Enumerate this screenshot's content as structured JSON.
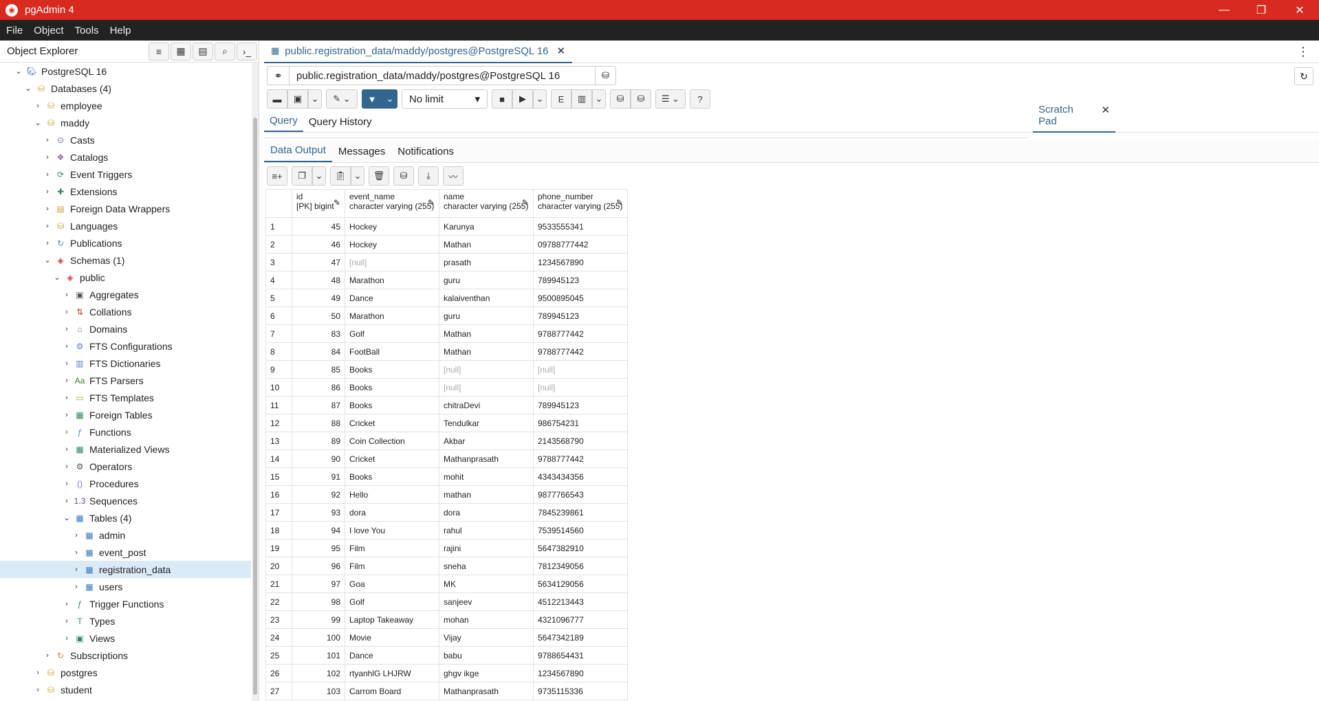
{
  "app": {
    "title": "pgAdmin 4",
    "accent_color": "#d92a1f",
    "brand_color": "#326690"
  },
  "menu": [
    "File",
    "Object",
    "Tools",
    "Help"
  ],
  "left_panel": {
    "title": "Object Explorer",
    "tree": [
      {
        "label": "PostgreSQL 16",
        "depth": 1,
        "expanded": true,
        "icon": "server-icon"
      },
      {
        "label": "Databases (4)",
        "depth": 2,
        "expanded": true,
        "icon": "databases-icon"
      },
      {
        "label": "employee",
        "depth": 3,
        "expanded": false,
        "icon": "database-error-icon"
      },
      {
        "label": "maddy",
        "depth": 3,
        "expanded": true,
        "icon": "database-icon"
      },
      {
        "label": "Casts",
        "depth": 4,
        "expanded": false,
        "icon": "casts-icon"
      },
      {
        "label": "Catalogs",
        "depth": 4,
        "expanded": false,
        "icon": "catalogs-icon"
      },
      {
        "label": "Event Triggers",
        "depth": 4,
        "expanded": false,
        "icon": "event-triggers-icon"
      },
      {
        "label": "Extensions",
        "depth": 4,
        "expanded": false,
        "icon": "extensions-icon"
      },
      {
        "label": "Foreign Data Wrappers",
        "depth": 4,
        "expanded": false,
        "icon": "fdw-icon"
      },
      {
        "label": "Languages",
        "depth": 4,
        "expanded": false,
        "icon": "languages-icon"
      },
      {
        "label": "Publications",
        "depth": 4,
        "expanded": false,
        "icon": "publications-icon"
      },
      {
        "label": "Schemas (1)",
        "depth": 4,
        "expanded": true,
        "icon": "schemas-icon"
      },
      {
        "label": "public",
        "depth": 5,
        "expanded": true,
        "icon": "schema-icon"
      },
      {
        "label": "Aggregates",
        "depth": 6,
        "expanded": false,
        "icon": "aggregates-icon"
      },
      {
        "label": "Collations",
        "depth": 6,
        "expanded": false,
        "icon": "collations-icon"
      },
      {
        "label": "Domains",
        "depth": 6,
        "expanded": false,
        "icon": "domains-icon"
      },
      {
        "label": "FTS Configurations",
        "depth": 6,
        "expanded": false,
        "icon": "fts-config-icon"
      },
      {
        "label": "FTS Dictionaries",
        "depth": 6,
        "expanded": false,
        "icon": "fts-dict-icon"
      },
      {
        "label": "FTS Parsers",
        "depth": 6,
        "expanded": false,
        "icon": "fts-parsers-icon"
      },
      {
        "label": "FTS Templates",
        "depth": 6,
        "expanded": false,
        "icon": "fts-templates-icon"
      },
      {
        "label": "Foreign Tables",
        "depth": 6,
        "expanded": false,
        "icon": "foreign-tables-icon"
      },
      {
        "label": "Functions",
        "depth": 6,
        "expanded": false,
        "icon": "functions-icon"
      },
      {
        "label": "Materialized Views",
        "depth": 6,
        "expanded": false,
        "icon": "mviews-icon"
      },
      {
        "label": "Operators",
        "depth": 6,
        "expanded": false,
        "icon": "operators-icon"
      },
      {
        "label": "Procedures",
        "depth": 6,
        "expanded": false,
        "icon": "procedures-icon"
      },
      {
        "label": "Sequences",
        "depth": 6,
        "expanded": false,
        "icon": "sequences-icon"
      },
      {
        "label": "Tables (4)",
        "depth": 6,
        "expanded": true,
        "icon": "tables-icon"
      },
      {
        "label": "admin",
        "depth": 7,
        "expanded": false,
        "icon": "table-icon"
      },
      {
        "label": "event_post",
        "depth": 7,
        "expanded": false,
        "icon": "table-icon"
      },
      {
        "label": "registration_data",
        "depth": 7,
        "expanded": false,
        "icon": "table-icon",
        "selected": true
      },
      {
        "label": "users",
        "depth": 7,
        "expanded": false,
        "icon": "table-icon"
      },
      {
        "label": "Trigger Functions",
        "depth": 6,
        "expanded": false,
        "icon": "trigger-functions-icon"
      },
      {
        "label": "Types",
        "depth": 6,
        "expanded": false,
        "icon": "types-icon"
      },
      {
        "label": "Views",
        "depth": 6,
        "expanded": false,
        "icon": "views-icon"
      },
      {
        "label": "Subscriptions",
        "depth": 4,
        "expanded": false,
        "icon": "subscriptions-icon"
      },
      {
        "label": "postgres",
        "depth": 3,
        "expanded": false,
        "icon": "database-icon"
      },
      {
        "label": "student",
        "depth": 3,
        "expanded": false,
        "icon": "database-error-icon"
      }
    ]
  },
  "doc_tab": {
    "title": "public.registration_data/maddy/postgres@PostgreSQL 16"
  },
  "connection": {
    "label": "public.registration_data/maddy/postgres@PostgreSQL 16"
  },
  "toolbar": {
    "limit": "No limit"
  },
  "query_tabs": {
    "query": "Query",
    "history": "Query History",
    "scratch": "Scratch Pad"
  },
  "output_tabs": {
    "data_output": "Data Output",
    "messages": "Messages",
    "notifications": "Notifications"
  },
  "grid": {
    "columns": [
      {
        "name": "id",
        "type": "[PK] bigint"
      },
      {
        "name": "event_name",
        "type": "character varying (255)"
      },
      {
        "name": "name",
        "type": "character varying (255)"
      },
      {
        "name": "phone_number",
        "type": "character varying (255)"
      }
    ],
    "null_text": "[null]",
    "rows": [
      [
        "1",
        "45",
        "Hockey",
        "Karunya",
        "9533555341"
      ],
      [
        "2",
        "46",
        "Hockey",
        "Mathan",
        "09788777442"
      ],
      [
        "3",
        "47",
        "[null]",
        "prasath",
        "1234567890"
      ],
      [
        "4",
        "48",
        "Marathon",
        "guru",
        "789945123"
      ],
      [
        "5",
        "49",
        "Dance",
        "kalaiventhan",
        "9500895045"
      ],
      [
        "6",
        "50",
        "Marathon",
        "guru",
        "789945123"
      ],
      [
        "7",
        "83",
        "Golf",
        "Mathan",
        "9788777442"
      ],
      [
        "8",
        "84",
        "FootBall",
        "Mathan",
        "9788777442"
      ],
      [
        "9",
        "85",
        "Books",
        "[null]",
        "[null]"
      ],
      [
        "10",
        "86",
        "Books",
        "[null]",
        "[null]"
      ],
      [
        "11",
        "87",
        "Books",
        "chitraDevi",
        "789945123"
      ],
      [
        "12",
        "88",
        "Cricket",
        "Tendulkar",
        "986754231"
      ],
      [
        "13",
        "89",
        "Coin Collection",
        "Akbar",
        "2143568790"
      ],
      [
        "14",
        "90",
        "Cricket",
        "Mathanprasath",
        "9788777442"
      ],
      [
        "15",
        "91",
        "Books",
        "mohit",
        "4343434356"
      ],
      [
        "16",
        "92",
        "Hello",
        "mathan",
        "9877766543"
      ],
      [
        "17",
        "93",
        "dora",
        "dora",
        "7845239861"
      ],
      [
        "18",
        "94",
        "I love You",
        "rahul",
        "7539514560"
      ],
      [
        "19",
        "95",
        "Film",
        "rajini",
        "5647382910"
      ],
      [
        "20",
        "96",
        "Film",
        "sneha",
        "7812349056"
      ],
      [
        "21",
        "97",
        "Goa",
        "MK",
        "5634129056"
      ],
      [
        "22",
        "98",
        "Golf",
        "sanjeev",
        "4512213443"
      ],
      [
        "23",
        "99",
        "Laptop Takeaway",
        "mohan",
        "4321096777"
      ],
      [
        "24",
        "100",
        "Movie",
        "Vijay",
        "5647342189"
      ],
      [
        "25",
        "101",
        "Dance",
        "babu",
        "9788654431"
      ],
      [
        "26",
        "102",
        "rtyanhlG LHJRW",
        "ghgv ikge",
        "1234567890"
      ],
      [
        "27",
        "103",
        "Carrom Board",
        "Mathanprasath",
        "9735115336"
      ]
    ]
  }
}
